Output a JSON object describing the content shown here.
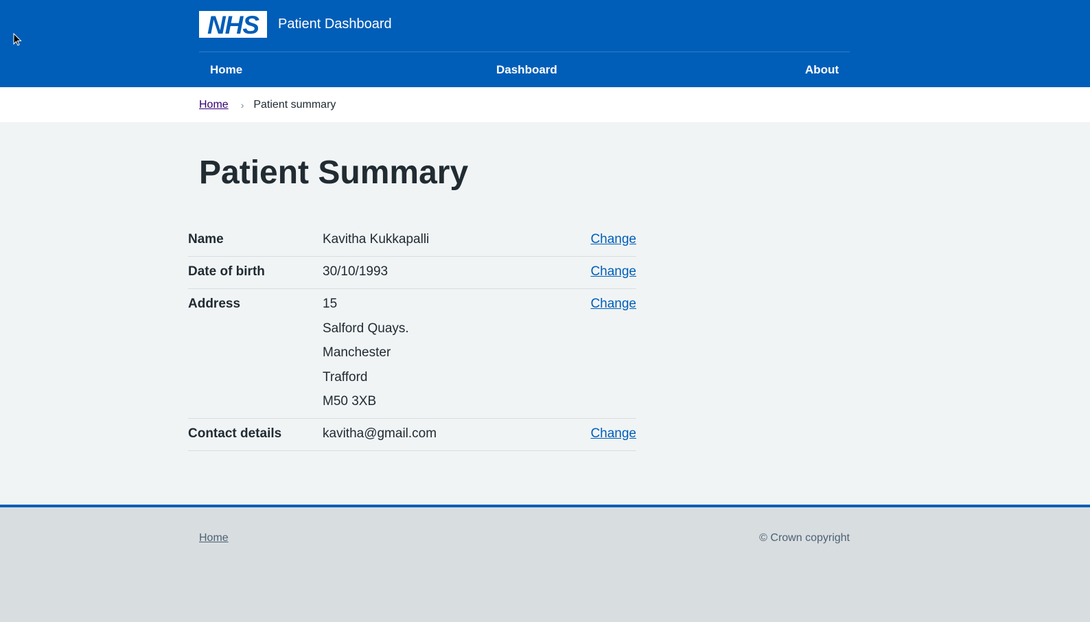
{
  "header": {
    "logo_text": "NHS",
    "service_name": "Patient Dashboard",
    "brand_color": "#005eb8",
    "nav": [
      {
        "label": "Home"
      },
      {
        "label": "Dashboard"
      },
      {
        "label": "About"
      }
    ]
  },
  "breadcrumb": {
    "home": "Home",
    "separator": "›",
    "current": "Patient summary"
  },
  "page_title": "Patient Summary",
  "summary": {
    "rows": [
      {
        "key": "Name",
        "value": [
          "Kavitha Kukkapalli"
        ],
        "action": "Change"
      },
      {
        "key": "Date of birth",
        "value": [
          "30/10/1993"
        ],
        "action": "Change"
      },
      {
        "key": "Address",
        "value": [
          "15",
          "Salford Quays.",
          "Manchester",
          "Trafford",
          "M50 3XB"
        ],
        "action": "Change"
      },
      {
        "key": "Contact details",
        "value": [
          "kavitha@gmail.com"
        ],
        "action": "Change"
      }
    ]
  },
  "footer": {
    "home_link": "Home",
    "copyright": "© Crown copyright"
  },
  "icons": {
    "cursor": "mouse-pointer-icon",
    "logo": "nhs-logo"
  }
}
